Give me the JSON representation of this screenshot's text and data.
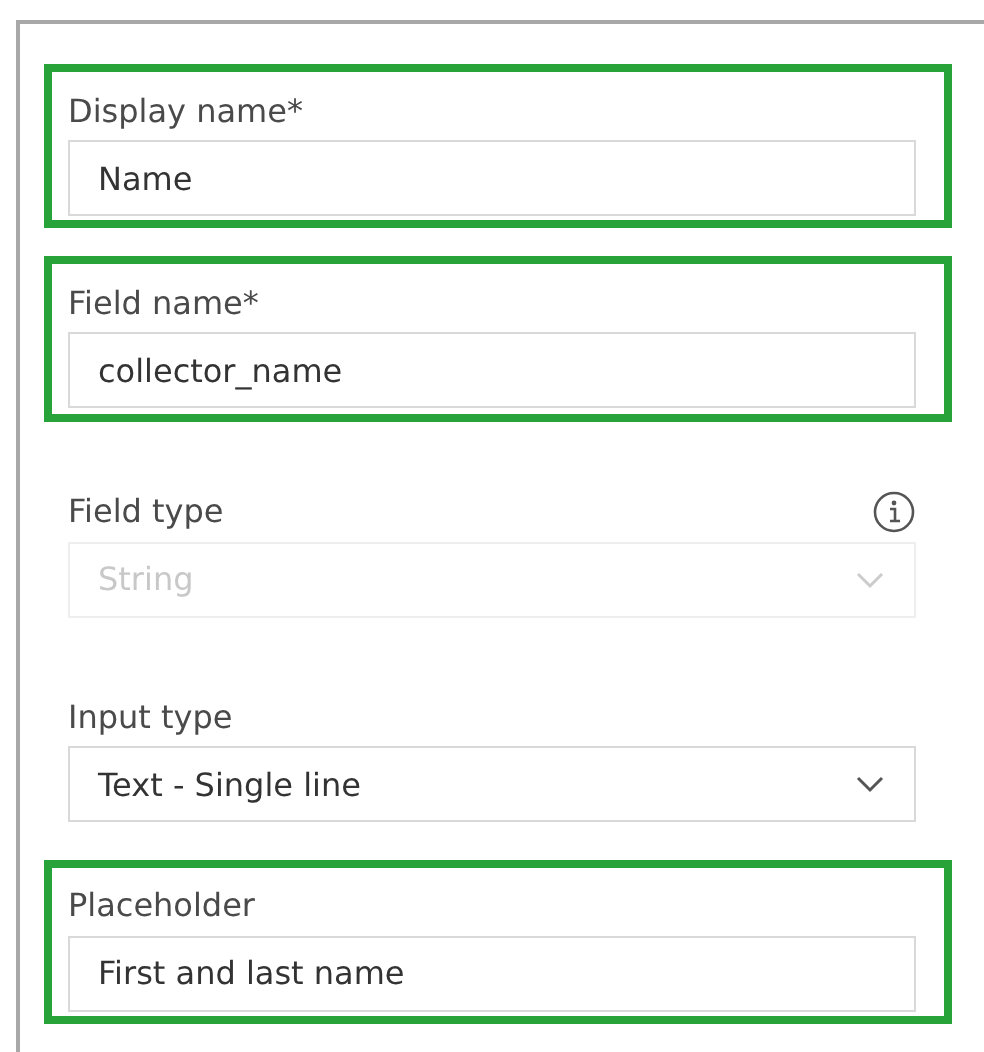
{
  "fields": [
    {
      "label": "Display name*",
      "kind": "text",
      "value": "Name",
      "highlighted": true,
      "disabled": false,
      "info": false
    },
    {
      "label": "Field name*",
      "kind": "text",
      "value": "collector_name",
      "highlighted": true,
      "disabled": false,
      "info": false
    },
    {
      "label": "Field type",
      "kind": "select",
      "value": "String",
      "highlighted": false,
      "disabled": true,
      "info": true
    },
    {
      "label": "Input type",
      "kind": "select",
      "value": "Text - Single line",
      "highlighted": false,
      "disabled": false,
      "info": false
    },
    {
      "label": "Placeholder",
      "kind": "text",
      "value": "First and last name",
      "highlighted": true,
      "disabled": false,
      "info": false
    }
  ]
}
